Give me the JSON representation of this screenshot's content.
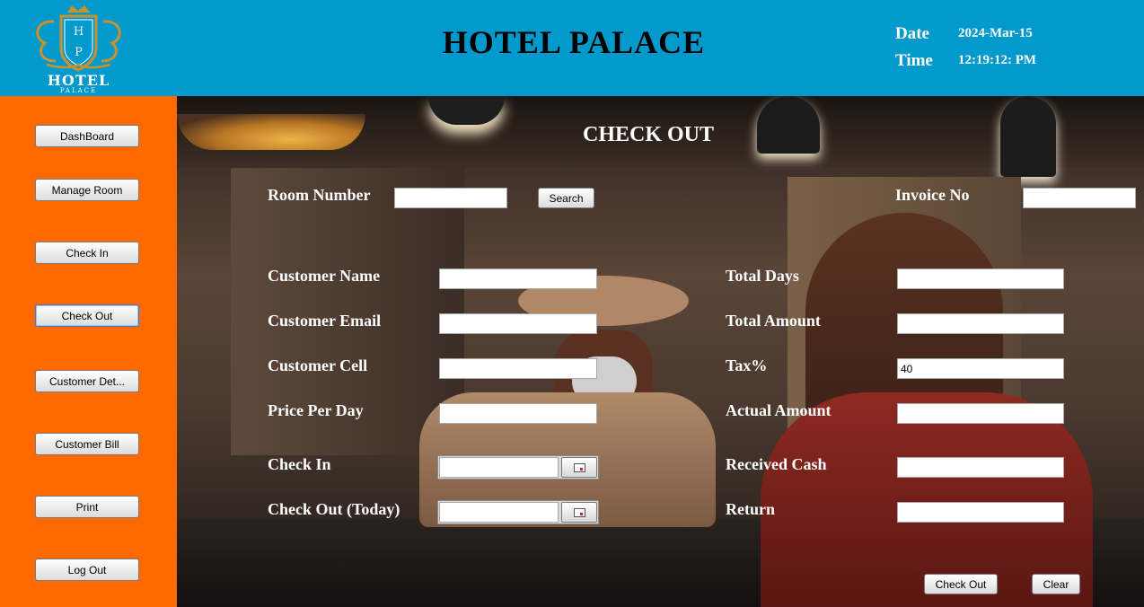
{
  "header": {
    "logo": {
      "initials_top": "H",
      "initials_bottom": "P",
      "word": "HOTEL",
      "sub": "PALACE"
    },
    "title": "HOTEL PALACE",
    "date_label": "Date",
    "date_value": "2024-Mar-15",
    "time_label": "Time",
    "time_value": "12:19:12: PM"
  },
  "sidebar": {
    "items": [
      {
        "label": "DashBoard"
      },
      {
        "label": "Manage Room"
      },
      {
        "label": "Check In"
      },
      {
        "label": "Check Out"
      },
      {
        "label": "Customer Det..."
      },
      {
        "label": "Customer Bill"
      },
      {
        "label": "Print"
      },
      {
        "label": "Log Out"
      }
    ]
  },
  "form": {
    "title": "CHECK OUT",
    "room_number_label": "Room Number",
    "room_number_value": "",
    "search_label": "Search",
    "invoice_label": "Invoice No",
    "invoice_value": "",
    "customer_name_label": "Customer Name",
    "customer_name_value": "",
    "customer_email_label": "Customer Email",
    "customer_email_value": "",
    "customer_cell_label": "Customer Cell",
    "customer_cell_value": "",
    "price_per_day_label": "Price Per Day",
    "price_per_day_value": "",
    "check_in_label": "Check In",
    "check_in_value": "",
    "check_out_label": "Check Out (Today)",
    "check_out_value": "",
    "total_days_label": "Total Days",
    "total_days_value": "",
    "total_amount_label": "Total Amount",
    "total_amount_value": "",
    "tax_label": "Tax%",
    "tax_value": "40",
    "actual_amount_label": "Actual Amount",
    "actual_amount_value": "",
    "received_cash_label": "Received Cash",
    "received_cash_value": "",
    "return_label": "Return",
    "return_value": "",
    "checkout_button_label": "Check Out",
    "clear_button_label": "Clear"
  },
  "colors": {
    "header_bg": "#0299cc",
    "sidebar_bg": "#ff6a00",
    "logo_gold": "#c8932e"
  },
  "icons": {
    "calendar": "calendar-icon"
  }
}
